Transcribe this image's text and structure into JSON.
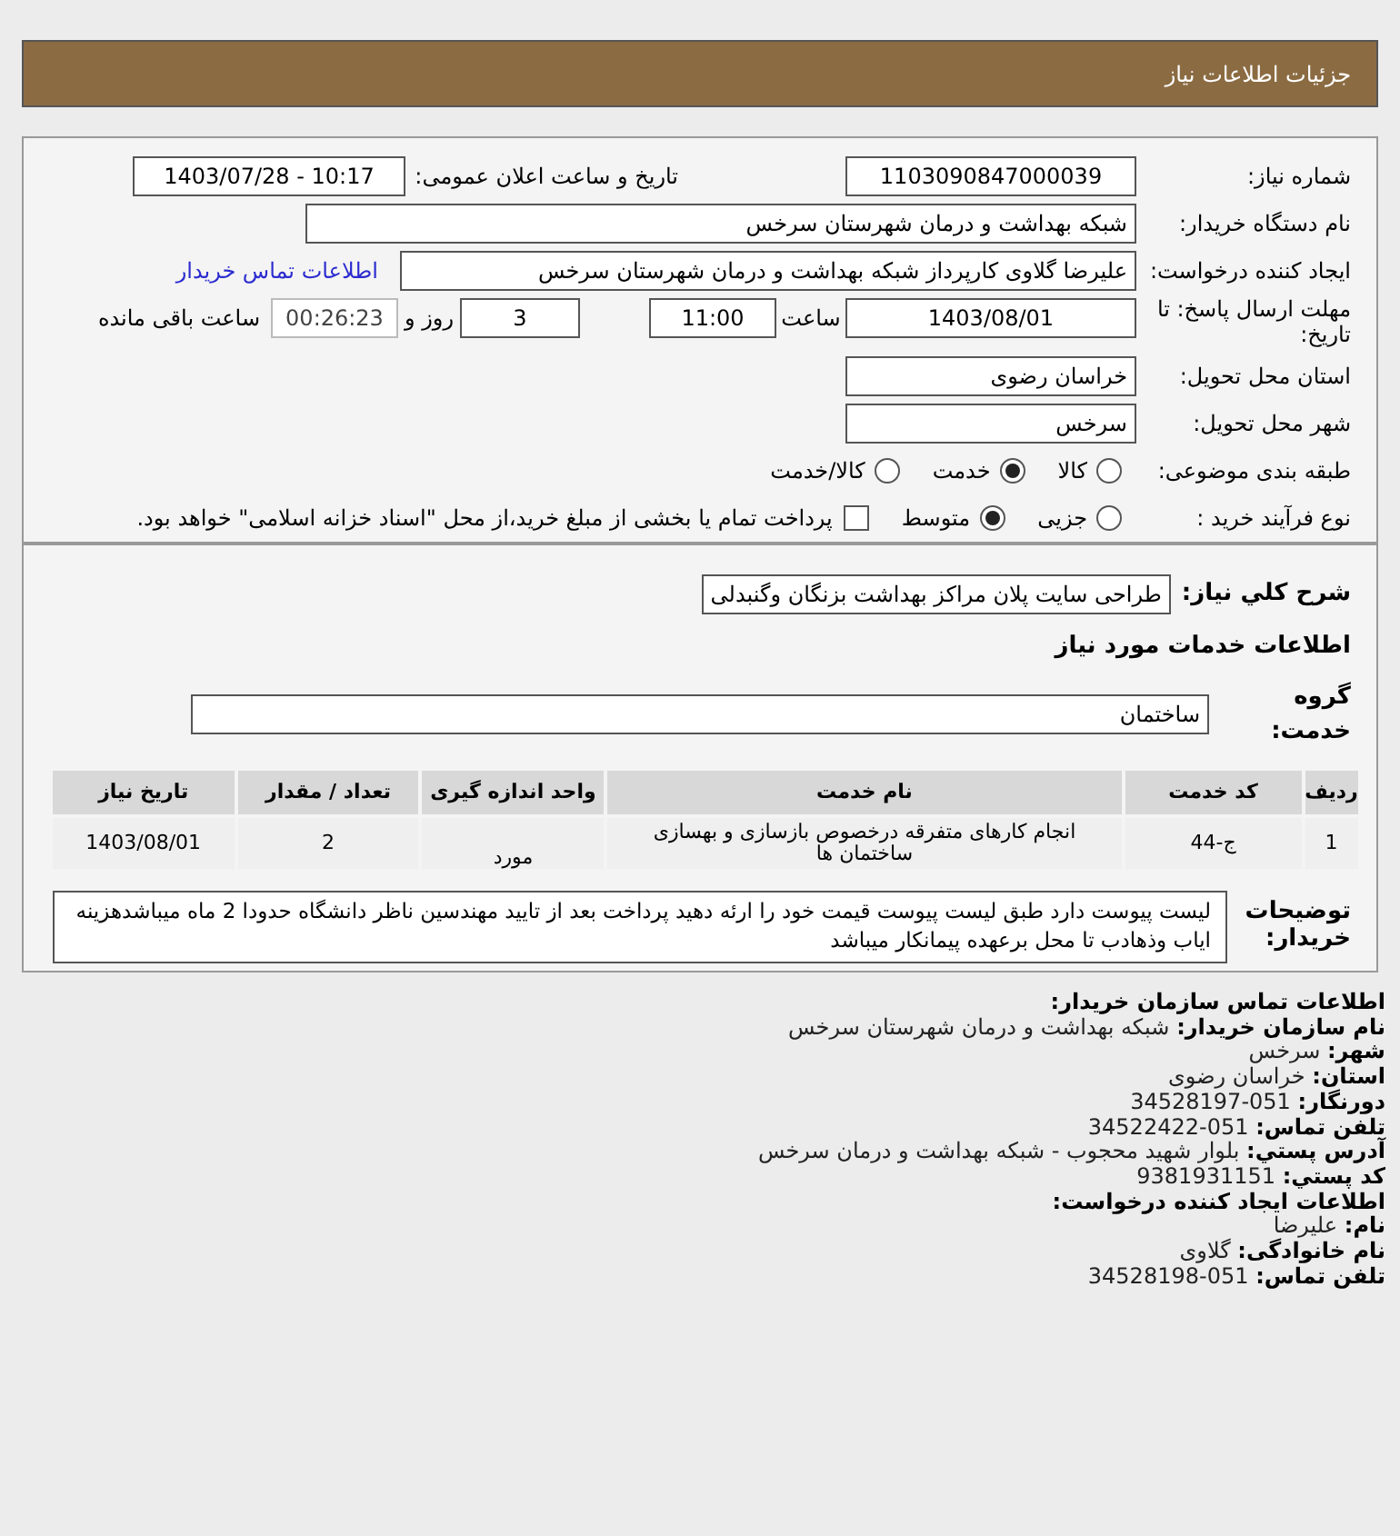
{
  "header": {
    "title": "جزئیات اطلاعات نیاز"
  },
  "form": {
    "need_number": {
      "label": "شماره نیاز:",
      "value": "1103090847000039"
    },
    "announce": {
      "label": "تاریخ و ساعت اعلان عمومی:",
      "value": "1403/07/28 - 10:17"
    },
    "buyer_org": {
      "label": "نام دستگاه خریدار:",
      "value": "شبکه بهداشت و درمان شهرستان سرخس"
    },
    "requester": {
      "label": "ایجاد کننده درخواست:",
      "value": "علیرضا گلاوی کارپرداز شبکه بهداشت و درمان شهرستان سرخس",
      "link": "اطلاعات تماس خریدار"
    },
    "deadline": {
      "label": "مهلت ارسال پاسخ: تا تاریخ:",
      "date": "1403/08/01",
      "time_label": "ساعت",
      "time": "11:00",
      "days": "3",
      "days_label": "روز و",
      "remaining": "00:26:23",
      "remaining_label": "ساعت باقی مانده"
    },
    "province": {
      "label": "استان محل تحویل:",
      "value": "خراسان رضوی"
    },
    "city": {
      "label": "شهر محل تحویل:",
      "value": "سرخس"
    },
    "category": {
      "label": "طبقه بندی موضوعی:",
      "options": [
        {
          "label": "کالا",
          "selected": false
        },
        {
          "label": "خدمت",
          "selected": true
        },
        {
          "label": "کالا/خدمت",
          "selected": false
        }
      ]
    },
    "process": {
      "label": "نوع فرآیند خرید :",
      "options": [
        {
          "label": "جزیی",
          "selected": false
        },
        {
          "label": "متوسط",
          "selected": true
        }
      ],
      "payment": {
        "label": "پرداخت تمام یا بخشی از مبلغ خرید،از محل \"اسناد خزانه اسلامی\" خواهد بود.",
        "checked": false
      }
    }
  },
  "details": {
    "summary": {
      "label": "شرح کلي نياز:",
      "value": "طراحی سایت پلان مراکز بهداشت بزنگان وگنبدلی"
    },
    "services_heading": "اطلاعات خدمات مورد نیاز",
    "service_group": {
      "label": "گروه خدمت:",
      "value": "ساختمان"
    },
    "table": {
      "columns": [
        "ردیف",
        "کد خدمت",
        "نام خدمت",
        "واحد اندازه گیری",
        "تعداد / مقدار",
        "تاریخ نیاز"
      ],
      "rows": [
        [
          "1",
          "ج-44",
          "انجام کارهای متفرقه درخصوص بازسازی و بهسازی ساختمان ها",
          "مورد",
          "2",
          "1403/08/01"
        ]
      ]
    },
    "notes": {
      "label": "توضیحات خریدار:",
      "value": "لیست پیوست دارد طبق لیست پیوست قیمت خود را ارئه دهید پرداخت بعد از تایید مهندسین ناظر دانشگاه حدودا 2 ماه میباشدهزینه ایاب وذهادب تا محل برعهده پیمانکار میباشد"
    }
  },
  "contact": [
    {
      "kind": "heading",
      "label": "اطلاعات تماس سازمان خریدار:"
    },
    {
      "kind": "field",
      "label": "نام سازمان خریدار:",
      "value": "شبکه بهداشت و درمان شهرستان سرخس"
    },
    {
      "kind": "field",
      "label": "شهر:",
      "value": "سرخس"
    },
    {
      "kind": "field",
      "label": "استان:",
      "value": "خراسان رضوی"
    },
    {
      "kind": "field",
      "label": "دورنگار:",
      "value": "051-34528197"
    },
    {
      "kind": "field",
      "label": "تلفن تماس:",
      "value": "051-34522422"
    },
    {
      "kind": "field",
      "label": "آدرس پستي:",
      "value": "بلوار شهید محجوب - شبکه بهداشت و درمان سرخس"
    },
    {
      "kind": "field",
      "label": "کد پستي:",
      "value": "9381931151"
    },
    {
      "kind": "heading",
      "label": "اطلاعات ایجاد کننده درخواست:"
    },
    {
      "kind": "field",
      "label": "نام:",
      "value": "علیرضا"
    },
    {
      "kind": "field",
      "label": "نام خانوادگی:",
      "value": "گلاوی"
    },
    {
      "kind": "field",
      "label": "تلفن تماس:",
      "value": "051-34528198"
    }
  ]
}
